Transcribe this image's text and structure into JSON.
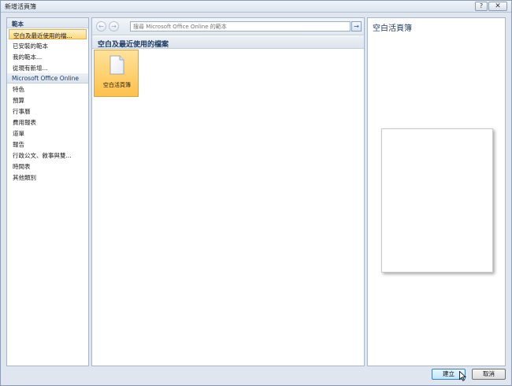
{
  "window": {
    "title": "新增活頁簿",
    "help_label": "?",
    "close_label": "✕"
  },
  "sidebar": {
    "templates_header": "範本",
    "items": [
      {
        "label": "空白及最近使用的檔..."
      },
      {
        "label": "已安裝的範本"
      },
      {
        "label": "我的範本..."
      },
      {
        "label": "從現有新增..."
      }
    ],
    "online_header": "Microsoft Office Online",
    "online_items": [
      {
        "label": "特色"
      },
      {
        "label": "預算"
      },
      {
        "label": "行事曆"
      },
      {
        "label": "費用報表"
      },
      {
        "label": "道單"
      },
      {
        "label": "報告"
      },
      {
        "label": "行政公文、敘事與雙..."
      },
      {
        "label": "時間表"
      },
      {
        "label": "其他類別"
      }
    ]
  },
  "toolbar": {
    "back_icon": "←",
    "forward_icon": "→",
    "search_placeholder": "搜尋 Microsoft Office Online 的範本",
    "search_go_icon": "→"
  },
  "main": {
    "title": "空白及最近使用的檔案",
    "tiles": [
      {
        "label": "空白活頁簿",
        "icon": "blank-document-icon"
      }
    ]
  },
  "preview": {
    "title": "空白活頁簿"
  },
  "footer": {
    "create_label": "建立",
    "cancel_label": "取消"
  },
  "colors": {
    "accent": "#1f3b63",
    "selection": "#ffc14a",
    "panel_border": "#a8b6c8"
  }
}
